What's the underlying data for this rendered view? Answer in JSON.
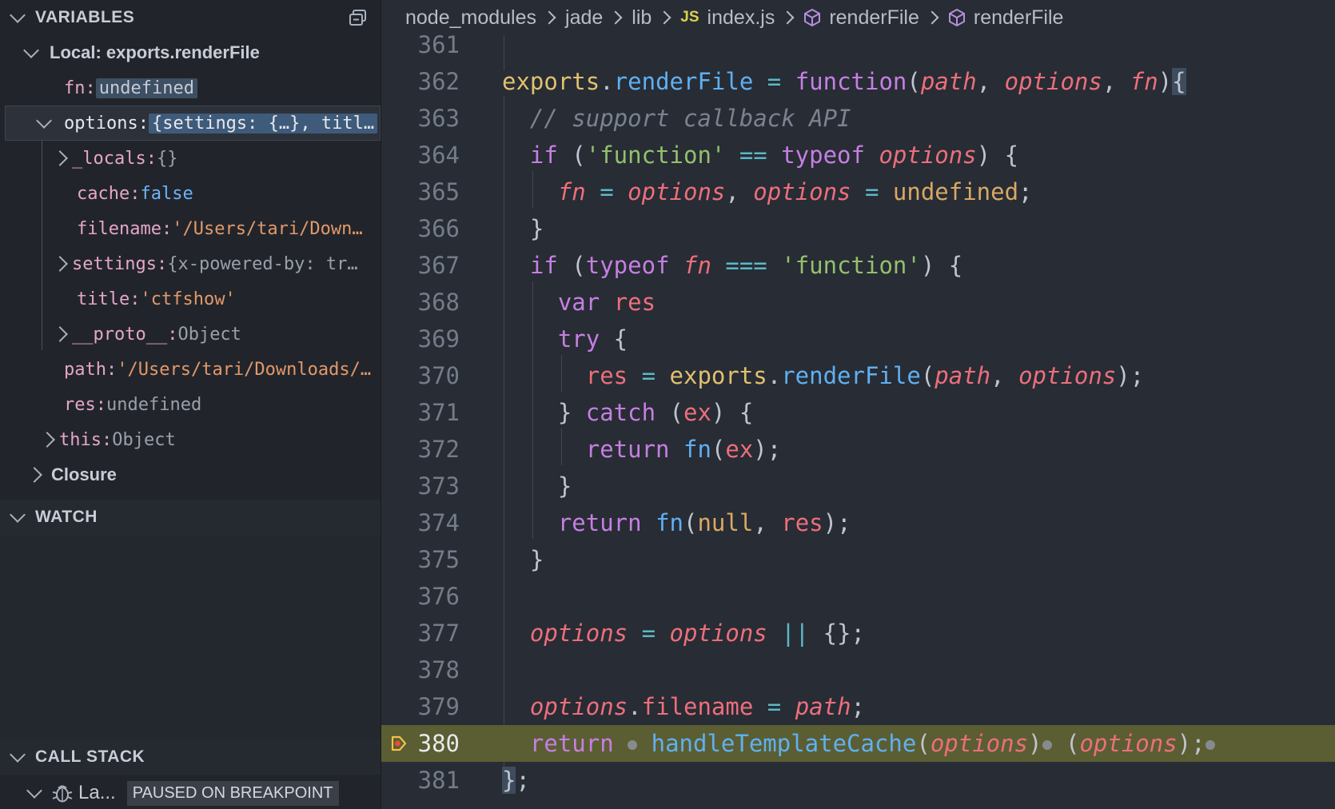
{
  "sidebar": {
    "variables_title": "VARIABLES",
    "watch_title": "WATCH",
    "callstack_title": "CALL STACK",
    "callstack_thread": "La...",
    "callstack_status": "PAUSED ON BREAKPOINT",
    "rows": [
      {
        "name": "Local: exports.renderFile",
        "value": ""
      },
      {
        "name": "fn: ",
        "value": "undefined"
      },
      {
        "name": "options: ",
        "value": "{settings: {…}, titl…"
      },
      {
        "name": "_locals: ",
        "value": "{}"
      },
      {
        "name": "cache: ",
        "value": "false"
      },
      {
        "name": "filename: ",
        "value": "'/Users/tari/Down…"
      },
      {
        "name": "settings: ",
        "value": "{x-powered-by: tr…"
      },
      {
        "name": "title: ",
        "value": "'ctfshow'"
      },
      {
        "name": "__proto__: ",
        "value": "Object"
      },
      {
        "name": "path: ",
        "value": "'/Users/tari/Downloads/…"
      },
      {
        "name": "res: ",
        "value": "undefined"
      },
      {
        "name": "this: ",
        "value": "Object"
      },
      {
        "name": "Closure",
        "value": ""
      }
    ]
  },
  "editor": {
    "breadcrumb": [
      "node_modules",
      "jade",
      "lib",
      "index.js",
      "renderFile",
      "renderFile"
    ],
    "js_badge": "JS",
    "line_numbers": [
      "361",
      "362",
      "363",
      "364",
      "365",
      "366",
      "367",
      "368",
      "369",
      "370",
      "371",
      "372",
      "373",
      "374",
      "375",
      "376",
      "377",
      "378",
      "379",
      "380",
      "381"
    ],
    "current_line": "380"
  }
}
